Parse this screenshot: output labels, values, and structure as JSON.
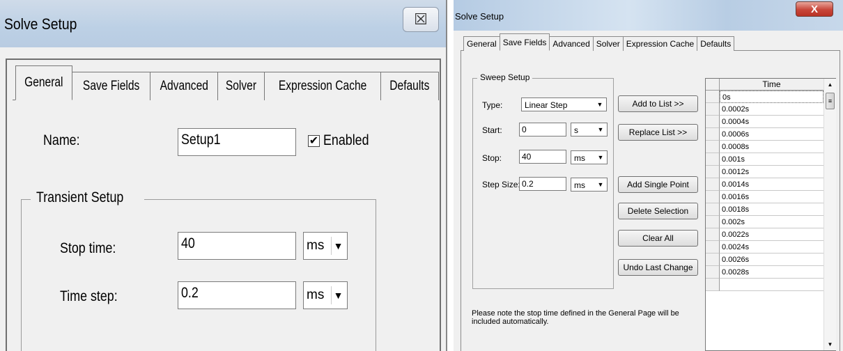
{
  "left_dialog": {
    "title": "Solve Setup",
    "close_glyph": "☒",
    "tabs": [
      "General",
      "Save Fields",
      "Advanced",
      "Solver",
      "Expression Cache",
      "Defaults"
    ],
    "active_tab": "General",
    "name_label": "Name:",
    "name_value": "Setup1",
    "enabled_label": "Enabled",
    "enabled_checked": true,
    "transient_group_label": "Transient Setup",
    "stop_time_label": "Stop time:",
    "stop_time_value": "40",
    "stop_time_unit": "ms",
    "time_step_label": "Time step:",
    "time_step_value": "0.2",
    "time_step_unit": "ms"
  },
  "right_dialog": {
    "title": "Solve Setup",
    "close_glyph": "X",
    "tabs": [
      "General",
      "Save Fields",
      "Advanced",
      "Solver",
      "Expression Cache",
      "Defaults"
    ],
    "active_tab": "Save Fields",
    "sweep_group_label": "Sweep Setup",
    "type_label": "Type:",
    "type_value": "Linear Step",
    "start_label": "Start:",
    "start_value": "0",
    "start_unit": "s",
    "stop_label": "Stop:",
    "stop_value": "40",
    "stop_unit": "ms",
    "step_size_label": "Step Size:",
    "step_size_value": "0.2",
    "step_size_unit": "ms",
    "buttons": {
      "add_to_list": "Add to List >>",
      "replace_list": "Replace List >>",
      "add_single_point": "Add Single Point",
      "delete_selection": "Delete Selection",
      "clear_all": "Clear All",
      "undo_last_change": "Undo Last Change"
    },
    "note": "Please note the stop time defined in the General Page will be included automatically.",
    "table": {
      "column_header": "Time",
      "rows": [
        "0s",
        "0.0002s",
        "0.0004s",
        "0.0006s",
        "0.0008s",
        "0.001s",
        "0.0012s",
        "0.0014s",
        "0.0016s",
        "0.0018s",
        "0.002s",
        "0.0022s",
        "0.0024s",
        "0.0026s",
        "0.0028s",
        ""
      ]
    }
  }
}
